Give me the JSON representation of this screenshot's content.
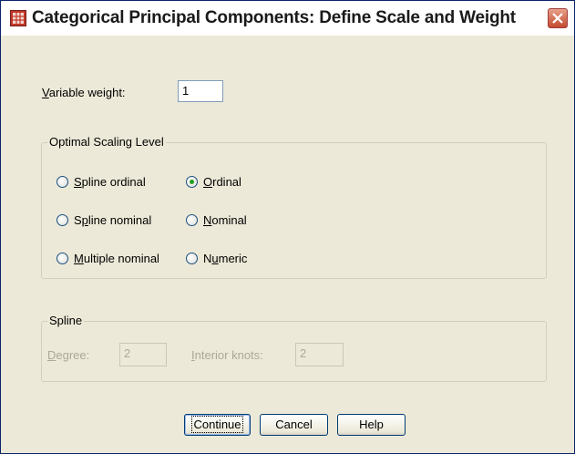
{
  "window": {
    "title": "Categorical Principal Components: Define Scale and Weight"
  },
  "variable_weight": {
    "label_first": "V",
    "label_rest": "ariable weight:",
    "value": "1"
  },
  "optimal_scaling": {
    "title": "Optimal Scaling Level",
    "options": [
      {
        "pre": "",
        "acc": "S",
        "post": "pline ordinal",
        "checked": false
      },
      {
        "pre": "",
        "acc": "O",
        "post": "rdinal",
        "checked": true
      },
      {
        "pre": "S",
        "acc": "p",
        "post": "line nominal",
        "checked": false
      },
      {
        "pre": "",
        "acc": "N",
        "post": "ominal",
        "checked": false
      },
      {
        "pre": "",
        "acc": "M",
        "post": "ultiple nominal",
        "checked": false
      },
      {
        "pre": "N",
        "acc": "u",
        "post": "meric",
        "checked": false
      }
    ]
  },
  "spline": {
    "title": "Spline",
    "degree_label_first": "D",
    "degree_label_rest": "egree:",
    "degree_value": "2",
    "knots_label_first": "I",
    "knots_label_rest": "nterior knots:",
    "knots_value": "2"
  },
  "buttons": {
    "continue": "Continue",
    "cancel": "Cancel",
    "help": "Help"
  }
}
